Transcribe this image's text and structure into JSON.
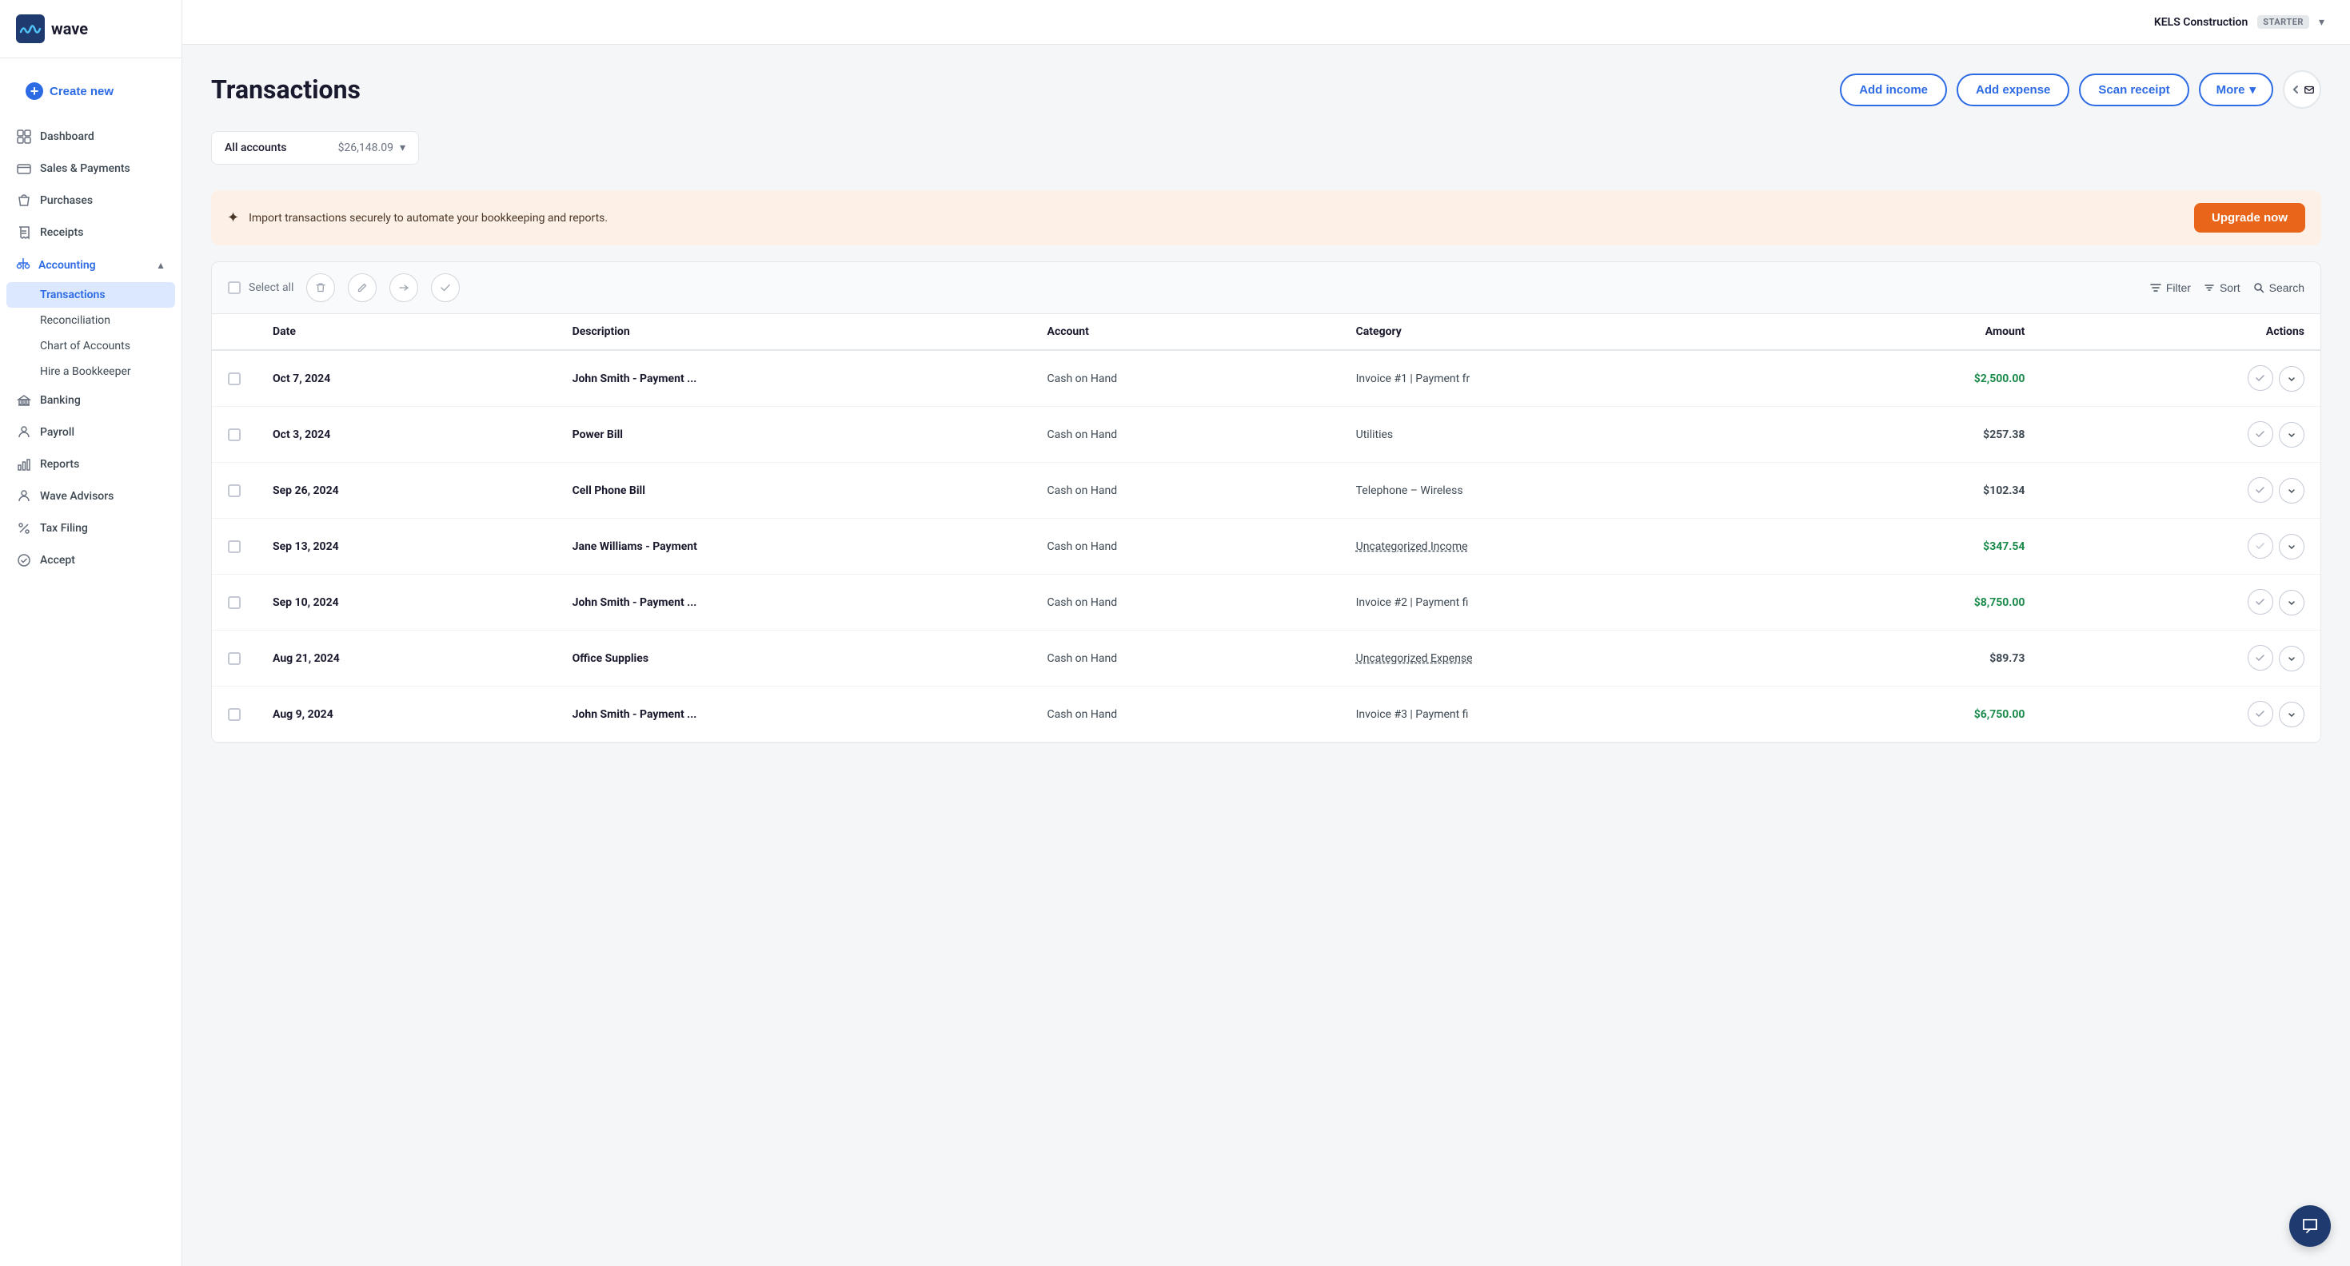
{
  "company": {
    "name": "KELS Construction",
    "plan": "STARTER"
  },
  "sidebar": {
    "logo_text": "wave",
    "create_new": "Create new",
    "nav_items": [
      {
        "id": "dashboard",
        "label": "Dashboard",
        "icon": "grid"
      },
      {
        "id": "sales-payments",
        "label": "Sales & Payments",
        "icon": "credit-card"
      },
      {
        "id": "purchases",
        "label": "Purchases",
        "icon": "shopping-bag"
      },
      {
        "id": "receipts",
        "label": "Receipts",
        "icon": "receipt"
      },
      {
        "id": "accounting",
        "label": "Accounting",
        "icon": "scale",
        "expanded": true
      },
      {
        "id": "banking",
        "label": "Banking",
        "icon": "bank"
      },
      {
        "id": "payroll",
        "label": "Payroll",
        "icon": "users"
      },
      {
        "id": "reports",
        "label": "Reports",
        "icon": "bar-chart"
      },
      {
        "id": "wave-advisors",
        "label": "Wave Advisors",
        "icon": "person"
      },
      {
        "id": "tax-filing",
        "label": "Tax Filing",
        "icon": "percent"
      }
    ],
    "accounting_subnav": [
      {
        "id": "transactions",
        "label": "Transactions",
        "active": true
      },
      {
        "id": "reconciliation",
        "label": "Reconciliation"
      },
      {
        "id": "chart-of-accounts",
        "label": "Chart of Accounts"
      },
      {
        "id": "hire-bookkeeper",
        "label": "Hire a Bookkeeper"
      }
    ],
    "bottom_item": "Accept"
  },
  "page": {
    "title": "Transactions"
  },
  "header_actions": {
    "add_income": "Add income",
    "add_expense": "Add expense",
    "scan_receipt": "Scan receipt",
    "more": "More"
  },
  "account_selector": {
    "label": "All accounts",
    "value": "$26,148.09"
  },
  "banner": {
    "icon": "✦",
    "text": "Import transactions securely to automate your bookkeeping and reports.",
    "cta": "Upgrade now"
  },
  "table_toolbar": {
    "select_all": "Select all",
    "filter": "Filter",
    "sort": "Sort",
    "search": "Search"
  },
  "table": {
    "columns": [
      "Date",
      "Description",
      "Account",
      "Category",
      "Amount",
      "Actions"
    ],
    "rows": [
      {
        "date": "Oct 7, 2024",
        "description": "John Smith - Payment ...",
        "account": "Cash on Hand",
        "category": "Invoice #1 | Payment fr",
        "amount": "$2,500.00",
        "income": true,
        "category_style": "plain"
      },
      {
        "date": "Oct 3, 2024",
        "description": "Power Bill",
        "account": "Cash on Hand",
        "category": "Utilities",
        "amount": "$257.38",
        "income": false,
        "category_style": "plain"
      },
      {
        "date": "Sep 26, 2024",
        "description": "Cell Phone Bill",
        "account": "Cash on Hand",
        "category": "Telephone – Wireless",
        "amount": "$102.34",
        "income": false,
        "category_style": "plain"
      },
      {
        "date": "Sep 13, 2024",
        "description": "Jane Williams - Payment",
        "account": "Cash on Hand",
        "category": "Uncategorized Income",
        "amount": "$347.54",
        "income": true,
        "category_style": "dashed"
      },
      {
        "date": "Sep 10, 2024",
        "description": "John Smith - Payment ...",
        "account": "Cash on Hand",
        "category": "Invoice #2 | Payment fi",
        "amount": "$8,750.00",
        "income": true,
        "category_style": "plain"
      },
      {
        "date": "Aug 21, 2024",
        "description": "Office Supplies",
        "account": "Cash on Hand",
        "category": "Uncategorized Expense",
        "amount": "$89.73",
        "income": false,
        "category_style": "dashed"
      },
      {
        "date": "Aug 9, 2024",
        "description": "John Smith - Payment ...",
        "account": "Cash on Hand",
        "category": "Invoice #3 | Payment fi",
        "amount": "$6,750.00",
        "income": true,
        "category_style": "plain"
      }
    ]
  }
}
